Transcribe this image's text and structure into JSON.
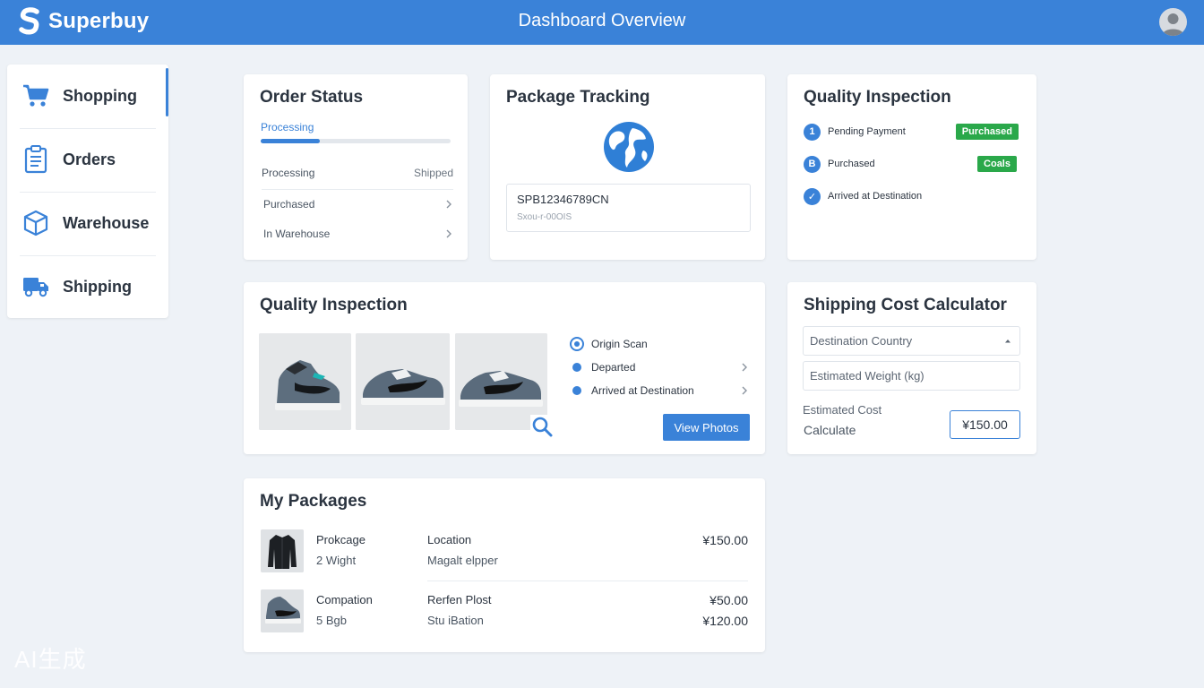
{
  "app": {
    "name": "Superbuy",
    "page_title": "Dashboard Overview",
    "accent": "#3a82d8"
  },
  "sidebar": {
    "items": [
      {
        "label": "Shopping",
        "icon": "cart-icon",
        "active": true
      },
      {
        "label": "Orders",
        "icon": "clipboard-icon"
      },
      {
        "label": "Warehouse",
        "icon": "box-icon"
      },
      {
        "label": "Shipping",
        "icon": "truck-icon"
      }
    ]
  },
  "order_status": {
    "title": "Order Status",
    "progress_label": "Processing",
    "progress_fraction": 0.31,
    "header_left": "Processing",
    "header_right": "Shipped",
    "rows": [
      "Purchased",
      "In Warehouse"
    ]
  },
  "package_tracking": {
    "title": "Package Tracking",
    "tracking_number": "SPB12346789CN",
    "tracking_sub": "Sxou-r-00OIS"
  },
  "quality_inspection_top": {
    "title": "Quality Inspection",
    "rows": [
      {
        "num": "1",
        "label": "Pending Payment",
        "badge": "Purchased"
      },
      {
        "num": "B",
        "label": "Purchased",
        "badge": "Coals"
      },
      {
        "num": "✓",
        "label": "Arrived at Destination",
        "badge": ""
      }
    ],
    "badge_color": "#2aa84a"
  },
  "quality_inspection": {
    "title": "Quality Inspection",
    "steps": [
      "Origin Scan",
      "Departed",
      "Arrived at Destination"
    ],
    "view_button": "View Photos"
  },
  "shipping_calc": {
    "title": "Shipping Cost Calculator",
    "country_placeholder": "Destination Country",
    "weight_placeholder": "Estimated Weight (kg)",
    "estimated_label": "Estimate⁠d Cost",
    "calculate_label": "Calculate",
    "cost_value": "¥150.00"
  },
  "my_packages": {
    "title": "My Packages",
    "items": [
      {
        "name": "Prokcage",
        "sub": "2 Wight",
        "loc": "Location",
        "loc2": "Magalt elpper",
        "price": "¥150.00",
        "price2": ""
      },
      {
        "name": "Compation",
        "sub": "5 Bgb",
        "loc": "Rerfen Plost",
        "loc2": "Stu iBation",
        "price": "¥50.00",
        "price2": "¥120.00"
      }
    ]
  },
  "watermark": "AI生成"
}
